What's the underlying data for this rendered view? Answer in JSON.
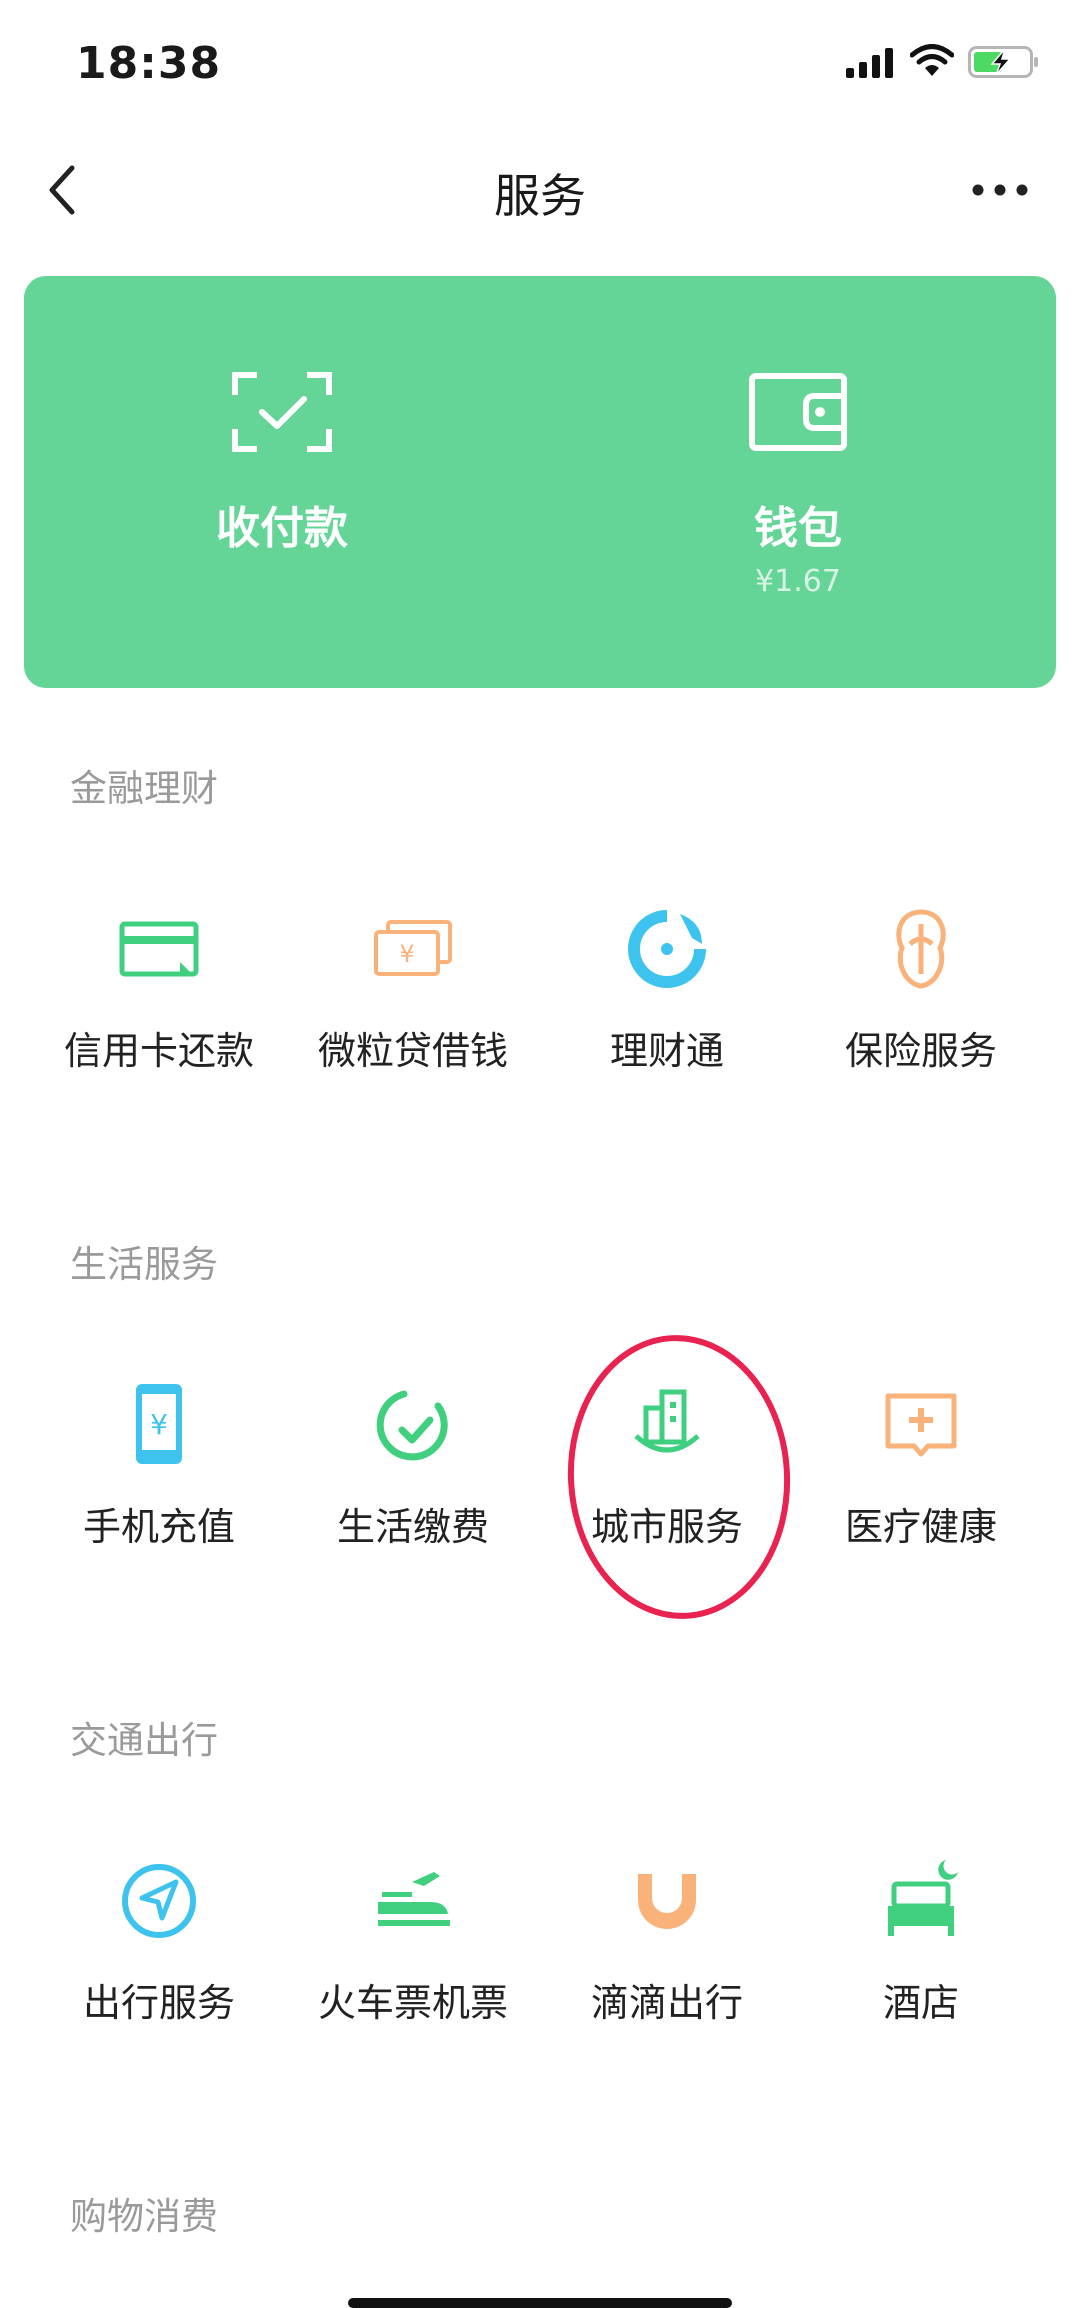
{
  "status_bar": {
    "time": "18:38"
  },
  "nav": {
    "title": "服务"
  },
  "wallet_card": {
    "pay_label": "收付款",
    "wallet_label": "钱包",
    "wallet_balance": "¥1.67",
    "background_color": "#64d597"
  },
  "sections": [
    {
      "title": "金融理财",
      "items": [
        {
          "label": "信用卡还款",
          "icon": "credit-card-icon"
        },
        {
          "label": "微粒贷借钱",
          "icon": "loan-icon"
        },
        {
          "label": "理财通",
          "icon": "wealth-icon"
        },
        {
          "label": "保险服务",
          "icon": "insurance-icon"
        }
      ]
    },
    {
      "title": "生活服务",
      "items": [
        {
          "label": "手机充值",
          "icon": "phone-topup-icon"
        },
        {
          "label": "生活缴费",
          "icon": "utility-bill-icon"
        },
        {
          "label": "城市服务",
          "icon": "city-services-icon"
        },
        {
          "label": "医疗健康",
          "icon": "medical-icon"
        }
      ]
    },
    {
      "title": "交通出行",
      "items": [
        {
          "label": "出行服务",
          "icon": "travel-icon"
        },
        {
          "label": "火车票机票",
          "icon": "train-plane-icon"
        },
        {
          "label": "滴滴出行",
          "icon": "didi-icon"
        },
        {
          "label": "酒店",
          "icon": "hotel-icon"
        }
      ]
    },
    {
      "title": "购物消费",
      "items": []
    }
  ],
  "colors": {
    "green": "#3fcf7e",
    "orange": "#f8b27a",
    "blue": "#3ec3ef",
    "annotation_red": "#e8234f"
  }
}
